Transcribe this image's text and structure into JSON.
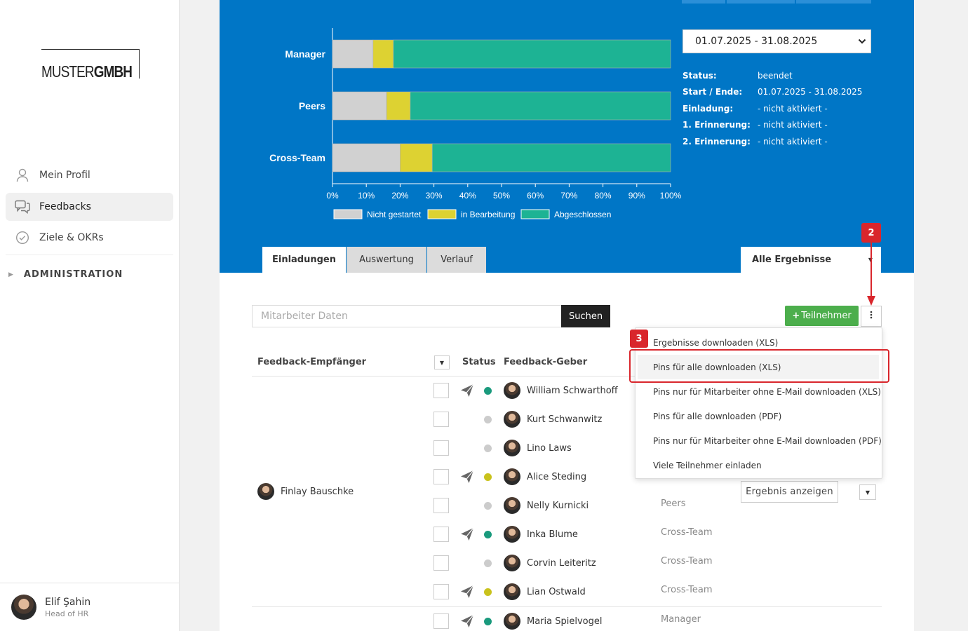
{
  "sidebar": {
    "logo_thin": "MUSTER",
    "logo_bold": "GMBH",
    "nav": [
      {
        "label": "Mein Profil",
        "icon": "user-icon"
      },
      {
        "label": "Feedbacks",
        "icon": "chat-icon"
      },
      {
        "label": "Ziele & OKRs",
        "icon": "check-circle-icon"
      }
    ],
    "admin_label": "ADMINISTRATION",
    "user": {
      "name": "Elif Şahin",
      "role": "Head of HR"
    }
  },
  "chart_data": {
    "type": "bar",
    "orientation": "horizontal",
    "stacked": true,
    "categories": [
      "Manager",
      "Peers",
      "Cross-Team"
    ],
    "series": [
      {
        "name": "Nicht gestartet",
        "color": "#d1d1d1",
        "values": [
          12,
          16,
          20
        ]
      },
      {
        "name": "in Bearbeitung",
        "color": "#ddd232",
        "values": [
          6,
          7,
          9.5
        ]
      },
      {
        "name": "Abgeschlossen",
        "color": "#1db394",
        "values": [
          82,
          77,
          70.5
        ]
      }
    ],
    "x_ticks": [
      "0%",
      "10%",
      "20%",
      "30%",
      "40%",
      "50%",
      "60%",
      "70%",
      "80%",
      "90%",
      "100%"
    ],
    "xlim": [
      0,
      100
    ],
    "legend": "bottom"
  },
  "period": {
    "selected": "01.07.2025 - 31.08.2025",
    "info": [
      {
        "key": "Status:",
        "value": "beendet"
      },
      {
        "key": "Start / Ende:",
        "value": "01.07.2025 - 31.08.2025"
      },
      {
        "key": "Einladung:",
        "value": "- nicht aktiviert -"
      },
      {
        "key": "1. Erinnerung:",
        "value": "- nicht aktiviert -"
      },
      {
        "key": "2. Erinnerung:",
        "value": "- nicht aktiviert -"
      }
    ]
  },
  "tabs": [
    "Einladungen",
    "Auswertung",
    "Verlauf"
  ],
  "results_filter": "Alle Ergebnisse",
  "callouts": {
    "two": "2",
    "three": "3"
  },
  "search": {
    "placeholder": "Mitarbeiter Daten",
    "button": "Suchen"
  },
  "actions": {
    "add_participants": "Teilnehmer"
  },
  "menu": [
    "Ergebnisse downloaden (XLS)",
    "Pins für alle downloaden (XLS)",
    "Pins nur für Mitarbeiter ohne E-Mail downloaden (XLS)",
    "Pins für alle downloaden (PDF)",
    "Pins nur für Mitarbeiter ohne E-Mail downloaden (PDF)",
    "Viele Teilnehmer einladen"
  ],
  "table": {
    "headers": {
      "recipient": "Feedback-Empfänger",
      "status": "Status",
      "giver": "Feedback-Geber"
    },
    "recipient": "Finlay Bauschke",
    "result_button": "Ergebnis anzeigen",
    "rows": [
      {
        "giver": "William Schwarthoff",
        "sent": true,
        "status_color": "#1a9a7d",
        "group": ""
      },
      {
        "giver": "Kurt Schwanwitz",
        "sent": false,
        "status_color": "#cccccc",
        "group": ""
      },
      {
        "giver": "Lino Laws",
        "sent": false,
        "status_color": "#cccccc",
        "group": ""
      },
      {
        "giver": "Alice Steding",
        "sent": true,
        "status_color": "#c9c21c",
        "group": ""
      },
      {
        "giver": "Nelly Kurnicki",
        "sent": false,
        "status_color": "#cccccc",
        "group": "Peers"
      },
      {
        "giver": "Inka Blume",
        "sent": true,
        "status_color": "#1a9a7d",
        "group": "Cross-Team"
      },
      {
        "giver": "Corvin Leiteritz",
        "sent": false,
        "status_color": "#cccccc",
        "group": "Cross-Team"
      },
      {
        "giver": "Lian Ostwald",
        "sent": true,
        "status_color": "#c9c21c",
        "group": "Cross-Team"
      },
      {
        "giver": "Maria Spielvogel",
        "sent": true,
        "status_color": "#1a9a7d",
        "group": "Manager"
      }
    ]
  }
}
